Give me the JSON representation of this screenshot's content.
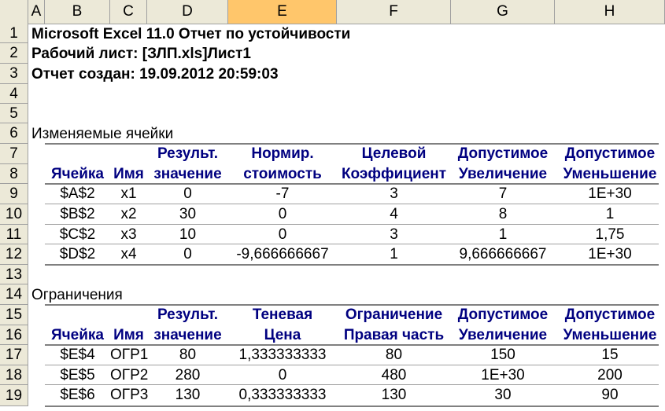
{
  "columns": [
    "A",
    "B",
    "C",
    "D",
    "E",
    "F",
    "G",
    "H"
  ],
  "selected_column": "E",
  "rows": [
    "1",
    "2",
    "3",
    "4",
    "5",
    "6",
    "7",
    "8",
    "9",
    "10",
    "11",
    "12",
    "13",
    "14",
    "15",
    "16",
    "17",
    "18",
    "19"
  ],
  "report": {
    "title": "Microsoft Excel 11.0 Отчет по устойчивости",
    "sheet": "Рабочий лист: [ЗЛП.xls]Лист1",
    "created": "Отчет создан: 19.09.2012 20:59:03"
  },
  "changing_cells": {
    "section_title": "Изменяемые ячейки",
    "header_top": [
      "",
      "",
      "Результ.",
      "Нормир.",
      "Целевой",
      "Допустимое",
      "Допустимое"
    ],
    "header_bottom": [
      "Ячейка",
      "Имя",
      "значение",
      "стоимость",
      "Коэффициент",
      "Увеличение",
      "Уменьшение"
    ],
    "rows": [
      [
        "$A$2",
        "x1",
        "0",
        "-7",
        "3",
        "7",
        "1E+30"
      ],
      [
        "$B$2",
        "x2",
        "30",
        "0",
        "4",
        "8",
        "1"
      ],
      [
        "$C$2",
        "x3",
        "10",
        "0",
        "3",
        "1",
        "1,75"
      ],
      [
        "$D$2",
        "x4",
        "0",
        "-9,666666667",
        "1",
        "9,666666667",
        "1E+30"
      ]
    ]
  },
  "constraints": {
    "section_title": "Ограничения",
    "header_top": [
      "",
      "",
      "Результ.",
      "Теневая",
      "Ограничение",
      "Допустимое",
      "Допустимое"
    ],
    "header_bottom": [
      "Ячейка",
      "Имя",
      "значение",
      "Цена",
      "Правая часть",
      "Увеличение",
      "Уменьшение"
    ],
    "rows": [
      [
        "$E$4",
        "ОГР1",
        "80",
        "1,333333333",
        "80",
        "150",
        "15"
      ],
      [
        "$E$5",
        "ОГР2",
        "280",
        "0",
        "480",
        "1E+30",
        "200"
      ],
      [
        "$E$6",
        "ОГР3",
        "130",
        "0,333333333",
        "130",
        "30",
        "90"
      ]
    ]
  }
}
